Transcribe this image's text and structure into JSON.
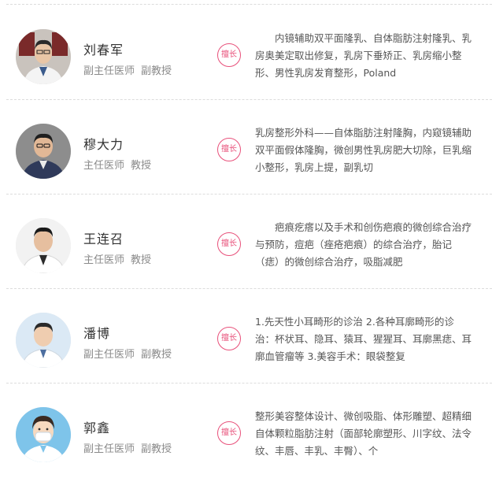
{
  "doctors": [
    {
      "name": "刘春军",
      "title": "副主任医师",
      "rank": "副教授",
      "badge": "擅长",
      "specialty": "内镜辅助双平面隆乳、自体脂肪注射隆乳、乳房奥美定取出修复，乳房下垂矫正、乳房缩小整形、男性乳房发育整形，Poland",
      "avatar_icon": "doctor-portrait-icon"
    },
    {
      "name": "穆大力",
      "title": "主任医师",
      "rank": "教授",
      "badge": "擅长",
      "specialty": "乳房整形外科——自体脂肪注射隆胸，内窥镜辅助双平面假体隆胸，微创男性乳房肥大切除，巨乳缩小整形，乳房上提，副乳切",
      "avatar_icon": "doctor-portrait-icon"
    },
    {
      "name": "王连召",
      "title": "主任医师",
      "rank": "教授",
      "badge": "擅长",
      "specialty": "疤痕疙瘩以及手术和创伤疤痕的微创综合治疗与预防，痘疤（痤疮疤痕）的综合治疗，胎记（痣）的微创综合治疗，吸脂减肥",
      "avatar_icon": "doctor-portrait-icon"
    },
    {
      "name": "潘博",
      "title": "副主任医师",
      "rank": "副教授",
      "badge": "擅长",
      "specialty": "1.先天性小耳畸形的诊治 2.各种耳廓畸形的诊治：杯状耳、隐耳、猿耳、猩猩耳、耳廓黑痣、耳廓血管瘤等 3.美容手术：眼袋整复",
      "avatar_icon": "doctor-portrait-icon"
    },
    {
      "name": "郭鑫",
      "title": "副主任医师",
      "rank": "副教授",
      "badge": "擅长",
      "specialty": "整形美容整体设计、微创吸脂、体形雕塑、超精细自体颗粒脂肪注射（面部轮廓塑形、川字纹、法令纹、丰唇、丰乳、丰臀）、个",
      "avatar_icon": "cartoon-doctor-avatar-icon"
    }
  ]
}
